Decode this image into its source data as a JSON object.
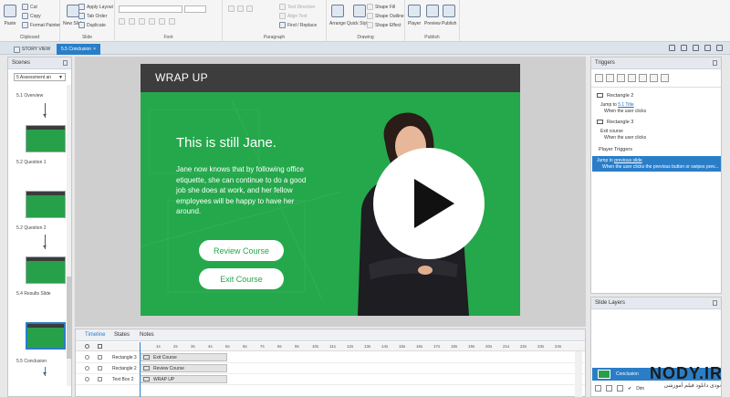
{
  "ribbon": {
    "clipboard": {
      "paste": "Paste",
      "cut": "Cut",
      "copy": "Copy",
      "format_painter": "Format Painter",
      "group": "Clipboard"
    },
    "slide": {
      "new_slide": "New Slide",
      "apply_layout": "Apply Layout",
      "tab_order": "Tab Order",
      "duplicate": "Duplicate",
      "group": "Slide"
    },
    "font": {
      "group": "Font"
    },
    "paragraph": {
      "text_direction": "Text Direction",
      "align_text": "Align Text",
      "find_replace": "Find / Replace",
      "group": "Paragraph"
    },
    "drawing": {
      "arrange": "Arrange",
      "quick_styles": "Quick Styles",
      "shape_fill": "Shape Fill",
      "shape_outline": "Shape Outline",
      "shape_effect": "Shape Effect",
      "group": "Drawing"
    },
    "publish": {
      "player": "Player",
      "preview": "Preview",
      "publish": "Publish",
      "group": "Publish"
    }
  },
  "tabs": {
    "story_view": "STORY VIEW",
    "active": "5.5 Conclusion"
  },
  "scenes": {
    "title": "Scenes",
    "selected_scene": "5 Assessment an",
    "slides": [
      "5.1 Overview",
      "5.2 Question 1",
      "5.2 Question 2",
      "5.4 Results Slide",
      "5.5 Conclusion"
    ]
  },
  "slide": {
    "header": "WRAP UP",
    "heading": "This is still Jane.",
    "body": "Jane now knows that by following office etiquette, she can continue to do a good job she does at work, and her fellow employees will be happy to have her around.",
    "review_button": "Review Course",
    "exit_button": "Exit Course"
  },
  "timeline": {
    "tabs": [
      "Timeline",
      "States",
      "Notes"
    ],
    "ticks": [
      "1s",
      "2s",
      "3s",
      "4s",
      "5s",
      "6s",
      "7s",
      "8s",
      "9s",
      "10s",
      "11s",
      "12s",
      "13s",
      "14s",
      "15s",
      "16s",
      "17s",
      "18s",
      "19s",
      "20s",
      "21s",
      "22s",
      "23s",
      "24s"
    ],
    "rows": [
      {
        "name": "Rectangle 3",
        "bar": "Exit Course"
      },
      {
        "name": "Rectangle 2",
        "bar": "Review Course"
      },
      {
        "name": "Text Box 2",
        "bar": "WRAP UP"
      }
    ]
  },
  "triggers": {
    "title": "Triggers",
    "items": [
      {
        "name": "Rectangle 2",
        "action": "Jump to",
        "target": "5.1 Title",
        "when": "When the user clicks"
      },
      {
        "name": "Rectangle 3",
        "action": "Exit course",
        "when": "When the user clicks"
      }
    ],
    "player_triggers": "Player Triggers",
    "selected": {
      "action": "Jump to",
      "target": "previous slide",
      "when": "When the user clicks the previous button or swipes prev..."
    }
  },
  "layers": {
    "title": "Slide Layers",
    "base": "Conclusion",
    "dim": "Dim"
  },
  "watermark": {
    "text": "NODY.IR",
    "sub": "نودی دانلود فیلم آموزشی"
  }
}
